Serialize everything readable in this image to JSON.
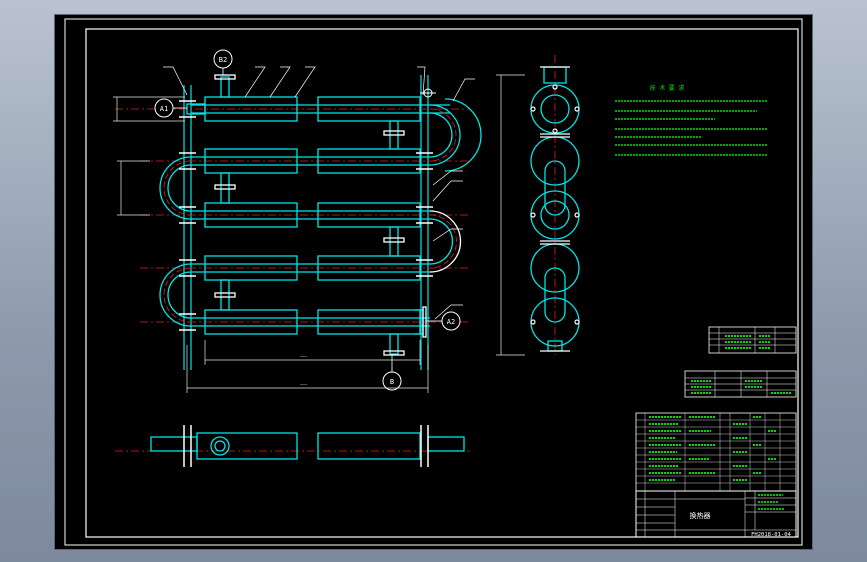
{
  "labels": {
    "nozzle_a1": "A1",
    "nozzle_a2": "A2",
    "nozzle_b1": "B",
    "nozzle_b2": "B2"
  },
  "title_block": {
    "name": "换热器",
    "drawing_no": "FH2018-01-04"
  },
  "notes_heading": "技 术 要 求",
  "colors": {
    "pipe": "#00e5e5",
    "centerline": "#e02020",
    "dimension": "#e8e8e8",
    "text": "#00e000",
    "flange": "#ffffff",
    "frame": "#ffffff"
  }
}
